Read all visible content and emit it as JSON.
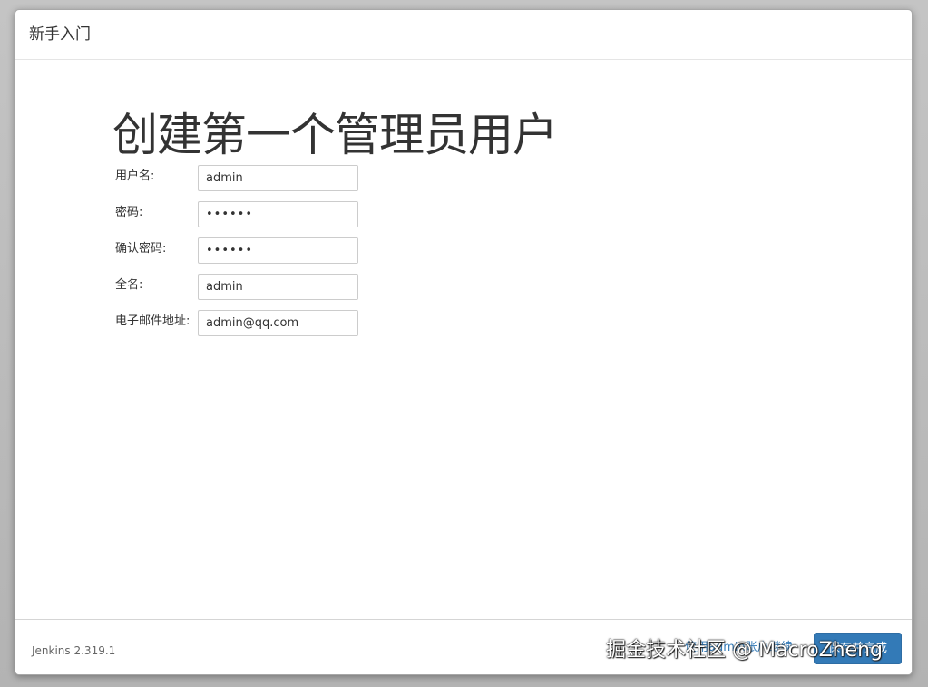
{
  "dialog": {
    "title": "新手入门",
    "heading": "创建第一个管理员用户"
  },
  "form": {
    "username": {
      "label": "用户名:",
      "value": "admin"
    },
    "password": {
      "label": "密码:",
      "value": "••••••"
    },
    "confirm_password": {
      "label": "确认密码:",
      "value": "••••••"
    },
    "full_name": {
      "label": "全名:",
      "value": "admin"
    },
    "email": {
      "label": "电子邮件地址:",
      "value": "admin@qq.com"
    }
  },
  "footer": {
    "version": "Jenkins 2.319.1",
    "admin_link": "使用admin账户继续",
    "save_button": "保存并完成"
  },
  "watermark": "掘金技术社区 @ MacroZheng",
  "colors": {
    "primary": "#337ab7",
    "text": "#333333"
  }
}
